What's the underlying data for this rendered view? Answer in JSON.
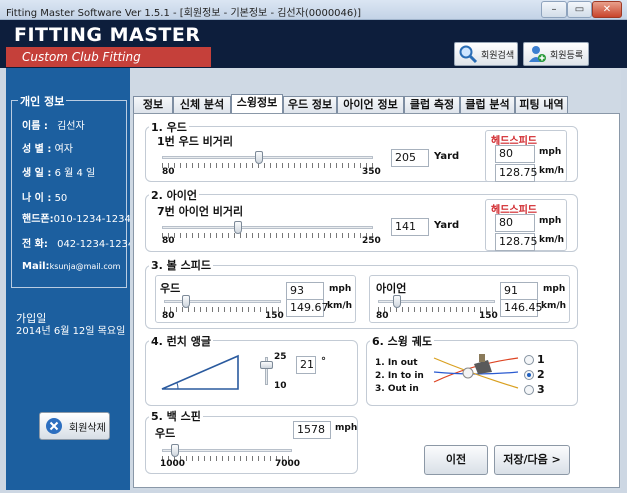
{
  "window": {
    "title": "Fitting Master Software Ver 1.5.1 - [회원정보 - 기본정보 - 김선자(0000046)]",
    "min": "–",
    "max": "▭",
    "close": "✕"
  },
  "header": {
    "brand": "FITTING MASTER",
    "tagline": "Custom Club Fitting",
    "search_label": "회원검색",
    "register_label": "회원등록"
  },
  "member": {
    "section_title": "개인 정보",
    "name_label": "이름 :",
    "name": "김선자",
    "gender_label": "성 별 :",
    "gender": "여자",
    "birthday_label": "생 일 :",
    "birthday": "6 월 4 일",
    "age_label": "나 이 :",
    "age": "50",
    "phone_label": "핸드폰:",
    "phone": "010-1234-1234",
    "tel_label": "전 화:",
    "tel": "042-1234-1234",
    "mail_label": "Mail:",
    "mail": "ksunja@mail.com",
    "joined_label": "가입일",
    "joined": "2014년 6월 12일 목요일",
    "delete_label": "회원삭제"
  },
  "tabs": [
    {
      "label": "정보"
    },
    {
      "label": "신체 분석"
    },
    {
      "label": "스윙정보"
    },
    {
      "label": "우드 정보"
    },
    {
      "label": "아이언 정보"
    },
    {
      "label": "클럽 측정"
    },
    {
      "label": "클럽 분석"
    },
    {
      "label": "피팅 내역"
    }
  ],
  "wood": {
    "title": "1. 우드",
    "sub": "1번 우드 비거리",
    "min": "80",
    "max": "350",
    "value": "205",
    "unit": "Yard",
    "slider_level": 0.46,
    "hs_title": "헤드스피드",
    "hs_mph": "80",
    "hs_mph_unit": "mph",
    "hs_kmh": "128.75",
    "hs_kmh_unit": "km/h"
  },
  "iron": {
    "title": "2. 아이언",
    "sub": "7번 아이언 비거리",
    "min": "80",
    "max": "250",
    "value": "141",
    "unit": "Yard",
    "slider_level": 0.36,
    "hs_title": "헤드스피드",
    "hs_mph": "80",
    "hs_mph_unit": "mph",
    "hs_kmh": "128.75",
    "hs_kmh_unit": "km/h"
  },
  "ball": {
    "title": "3. 볼 스피드",
    "wood_label": "우드",
    "wood_mph": "93",
    "wood_kmh": "149.67",
    "wood_min": "80",
    "wood_max": "150",
    "wood_level": 0.19,
    "iron_label": "아이언",
    "iron_mph": "91",
    "iron_kmh": "146.45",
    "iron_min": "80",
    "iron_max": "150",
    "iron_level": 0.16,
    "mph": "mph",
    "kmh": "km/h"
  },
  "launch": {
    "title": "4. 런치 앵글",
    "max": "25",
    "min": "10",
    "value": "21",
    "unit": "°",
    "slider_level": 0.73
  },
  "path": {
    "title": "6. 스윙 궤도",
    "options": [
      {
        "label": "1. In out"
      },
      {
        "label": "2. In to in"
      },
      {
        "label": "3. Out in"
      }
    ],
    "radios": [
      {
        "label": "1"
      },
      {
        "label": "2"
      },
      {
        "label": "3"
      }
    ],
    "selected": "2"
  },
  "spin": {
    "title": "5. 백 스핀",
    "label": "우드",
    "value": "1578",
    "unit": "mph",
    "min": "1000",
    "max": "7000",
    "slider_level": 0.1
  },
  "buttons": {
    "prev": "이전",
    "save": "저장/다음 >"
  }
}
